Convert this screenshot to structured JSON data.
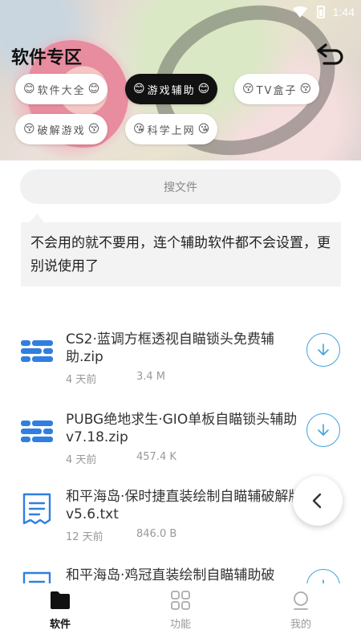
{
  "status_bar": {
    "time": "1:44"
  },
  "header": {
    "title": "软件专区",
    "chips": [
      {
        "label": "软件大全",
        "emoji": "😊",
        "active": false
      },
      {
        "label": "游戏辅助",
        "emoji": "😊",
        "active": true
      },
      {
        "label": "TV盒子",
        "emoji": "😚",
        "active": false
      },
      {
        "label": "破解游戏",
        "emoji": "😚",
        "active": false
      },
      {
        "label": "科学上网",
        "emoji": "😘",
        "active": false
      }
    ]
  },
  "search": {
    "placeholder": "搜文件"
  },
  "notice": {
    "text": "不会用的就不要用，连个辅助软件都不会设置，更别说使用了"
  },
  "files": [
    {
      "name": "CS2·蓝调方框透视自瞄锁头免费辅助.zip",
      "date": "4 天前",
      "size": "3.4 M",
      "icon": "archive-icon"
    },
    {
      "name": "PUBG绝地求生·GIO单板自瞄锁头辅助 v7.18.zip",
      "date": "4 天前",
      "size": "457.4 K",
      "icon": "archive-icon"
    },
    {
      "name": "和平海岛·保时捷直装绘制自瞄辅破解版 v5.6.txt",
      "date": "12 天前",
      "size": "846.0 B",
      "icon": "text-file-icon"
    },
    {
      "name": "和平海岛·鸡冠直装绘制自瞄辅助破",
      "date": "",
      "size": "",
      "icon": "text-file-icon"
    }
  ],
  "bottom_nav": {
    "items": [
      {
        "label": "软件",
        "icon": "folder-icon",
        "active": true
      },
      {
        "label": "功能",
        "icon": "grid-icon",
        "active": false
      },
      {
        "label": "我的",
        "icon": "user-icon",
        "active": false
      }
    ]
  },
  "colors": {
    "accent": "#3fa5dc",
    "archive_icon": "#2f7fe0",
    "active_chip_bg": "#111111"
  }
}
